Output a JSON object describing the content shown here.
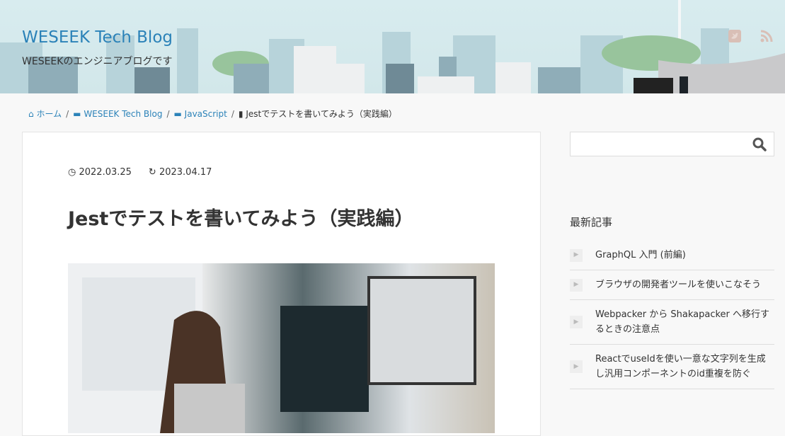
{
  "header": {
    "title": "WESEEK Tech Blog",
    "description": "WESEEKのエンジニアブログです",
    "sns": [
      "twitter-icon",
      "rss-icon"
    ]
  },
  "breadcrumb": [
    {
      "label": "ホーム",
      "icon": "home-icon"
    },
    {
      "label": "WESEEK Tech Blog",
      "icon": "folder-icon"
    },
    {
      "label": "JavaScript",
      "icon": "folder-icon"
    },
    {
      "label": "Jestでテストを書いてみよう（実践編）",
      "icon": "file-icon"
    }
  ],
  "article": {
    "published": "2022.03.25",
    "updated": "2023.04.17",
    "title": "Jestでテストを書いてみよう（実践編）"
  },
  "sidebar": {
    "search": {
      "value": "",
      "placeholder": ""
    },
    "recent_title": "最新記事",
    "recent": [
      "GraphQL 入門 (前編)",
      "ブラウザの開発者ツールを使いこなそう",
      "Webpacker から Shakapacker へ移行するときの注意点",
      "ReactでuseIdを使い一意な文字列を生成し汎用コンポーネントのid重複を防ぐ"
    ]
  }
}
